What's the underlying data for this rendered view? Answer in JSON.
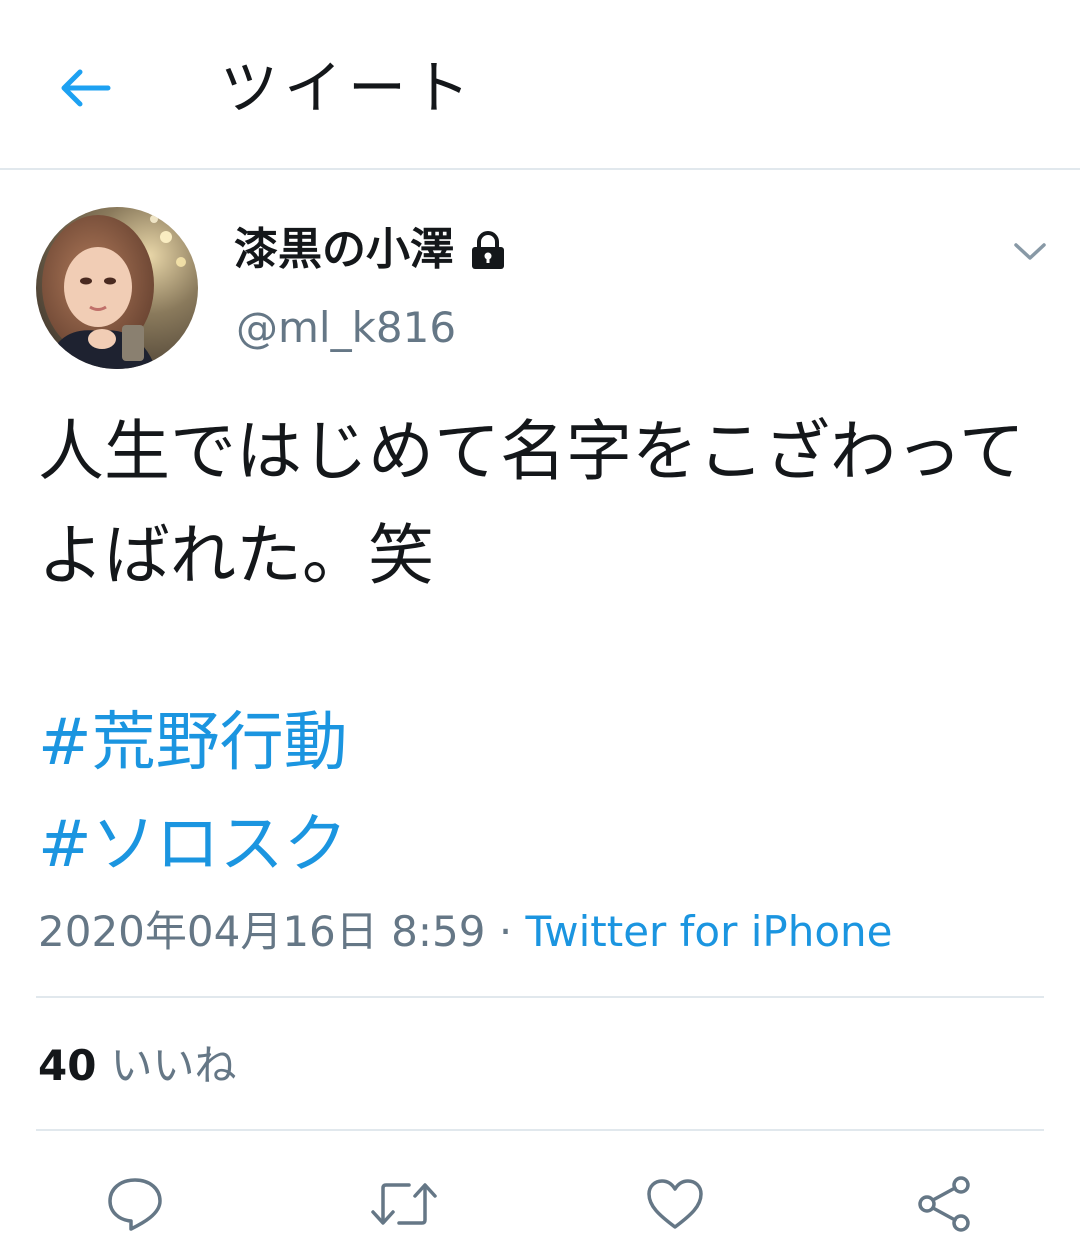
{
  "header": {
    "title": "ツイート",
    "back_icon": "arrow-left-icon",
    "accent_color": "#1da1f2"
  },
  "author": {
    "display_name": "漆黒の小澤",
    "handle": "@ml_k816",
    "protected_icon": "lock-icon"
  },
  "tweet": {
    "text_line1": "人生ではじめて名字をこざわって",
    "text_line2": "よばれた。笑",
    "hashtags": [
      "#荒野行動",
      "#ソロスク"
    ],
    "timestamp": "2020年04月16日 8:59",
    "separator": "·",
    "source": "Twitter for iPhone"
  },
  "stats": {
    "likes_count": "40",
    "likes_label": "いいね"
  },
  "actions": [
    {
      "name": "reply",
      "icon": "reply-icon"
    },
    {
      "name": "retweet",
      "icon": "retweet-icon"
    },
    {
      "name": "like",
      "icon": "heart-icon"
    },
    {
      "name": "share",
      "icon": "share-icon"
    }
  ],
  "colors": {
    "link": "#1b95e0",
    "secondary_text": "#657786",
    "divider": "#e1e8ed",
    "icon_gray": "#657786"
  }
}
